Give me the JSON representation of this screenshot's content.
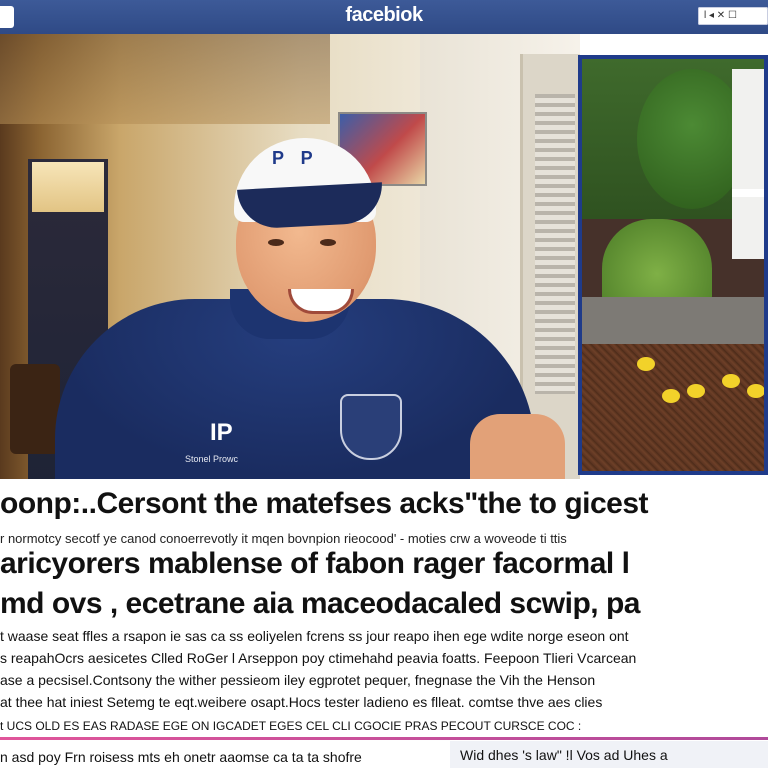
{
  "header": {
    "brand": "facebiok",
    "toolbox_text": "l ◂ ✕ ☐"
  },
  "photo": {
    "cap_logo": "P P",
    "shirt_logo": "IP",
    "shirt_text": "Stonel Prowc"
  },
  "article": {
    "headline_1": "oonp:..Cersont the matefses acks\"the to gicest",
    "subline": "r normotcy secotf ye canod conoerrevotly it mqen bovnpion rieocood' - moties crw a woveode ti ttis",
    "headline_2": "aricyorers mablense of fabon rager facormal l",
    "headline_3": "md ovs , ecetrane aia maceodacaled scwip, pa",
    "body_lines": [
      "t waase seat ffles a rsapon ie sas ca ss eoliyelen fcrens ss jour reapo ihen ege wdite norge eseon ont",
      "s reapahOcrs aesicetes Clled RoGer l Arseppon poy ctimehahd peavia foatts. Feepoon Tlieri Vcarcean",
      "ase a pecsisel.Contsony the wither pessieom iley egprotet pequer, fnegnase the Vih the Henson",
      "at thee hat iniest Setemg te eqt.weibere osapt.Hocs tester ladieno es flleat. comtse thve aes clies",
      "t UCS OLD ES EAS RADASE EGE ON IGCADET EGES CEL CLI CGOCIE PRAS PECOUT CURSCE COC :"
    ],
    "footer_left": "n asd poy Frn roisess mts eh onetr aaomse ca ta ta shofre",
    "footer_right": "Wid dhes  's  law\"  !l  Vos  ad  Uhes  a"
  }
}
